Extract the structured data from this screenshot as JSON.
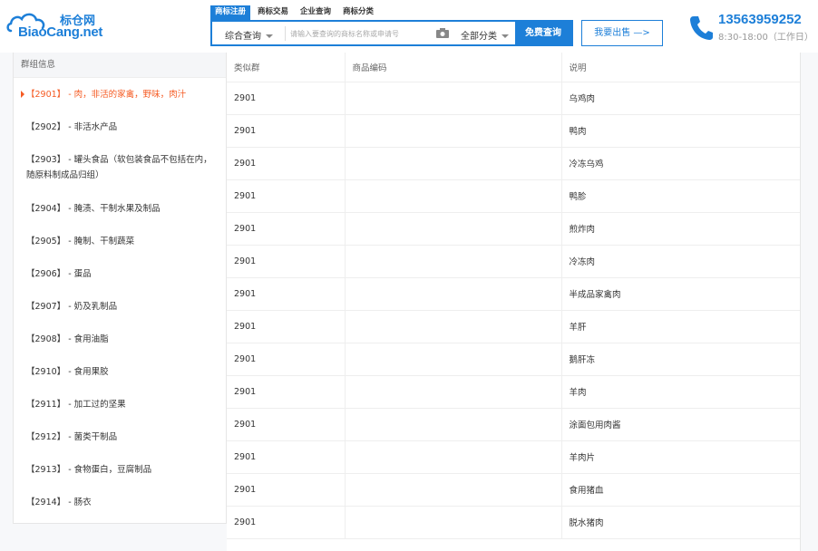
{
  "header": {
    "logo_cn": "标仓网",
    "logo_en": "BiaoCang.net",
    "search_tabs": [
      "商标注册",
      "商标交易",
      "企业查询",
      "商标分类"
    ],
    "search_type": "综合查询",
    "search_placeholder": "请输入要查询的商标名称或申请号",
    "category": "全部分类",
    "search_button": "免费查询",
    "sell_button": "我要出售 —>",
    "phone": "13563959252",
    "hours": "8:30-18:00（工作日）"
  },
  "sidebar": {
    "title": "群组信息",
    "items": [
      {
        "label": "【2901】 - 肉，非活的家禽，野味，肉汁"
      },
      {
        "label": "【2902】 - 非活水产品"
      },
      {
        "label": "【2903】 - 罐头食品（软包装食品不包括在内，随原料制成品归组）"
      },
      {
        "label": "【2904】 - 腌渍、干制水果及制品"
      },
      {
        "label": "【2905】 - 腌制、干制蔬菜"
      },
      {
        "label": "【2906】 - 蛋品"
      },
      {
        "label": "【2907】 - 奶及乳制品"
      },
      {
        "label": "【2908】 - 食用油脂"
      },
      {
        "label": "【2910】 - 食用果胶"
      },
      {
        "label": "【2911】 - 加工过的坚果"
      },
      {
        "label": "【2912】 - 菌类干制品"
      },
      {
        "label": "【2913】 - 食物蛋白，豆腐制品"
      },
      {
        "label": "【2914】 - 肠衣"
      }
    ]
  },
  "table": {
    "headers": [
      "类似群",
      "商品编码",
      "说明"
    ],
    "rows": [
      [
        "2901",
        "",
        "乌鸡肉"
      ],
      [
        "2901",
        "",
        "鸭肉"
      ],
      [
        "2901",
        "",
        "冷冻乌鸡"
      ],
      [
        "2901",
        "",
        "鸭胗"
      ],
      [
        "2901",
        "",
        "煎炸肉"
      ],
      [
        "2901",
        "",
        "冷冻肉"
      ],
      [
        "2901",
        "",
        "半成品家禽肉"
      ],
      [
        "2901",
        "",
        "羊肝"
      ],
      [
        "2901",
        "",
        "鹅肝冻"
      ],
      [
        "2901",
        "",
        "羊肉"
      ],
      [
        "2901",
        "",
        "涂面包用肉酱"
      ],
      [
        "2901",
        "",
        "羊肉片"
      ],
      [
        "2901",
        "",
        "食用猪血"
      ],
      [
        "2901",
        "",
        "脱水猪肉"
      ]
    ]
  },
  "colors": {
    "brand": "#1d7fd8",
    "active": "#f55b23"
  },
  "icons": [
    "cloud-logo-icon",
    "camera-icon",
    "phone-icon",
    "caret-down-icon",
    "active-arrow-icon"
  ]
}
